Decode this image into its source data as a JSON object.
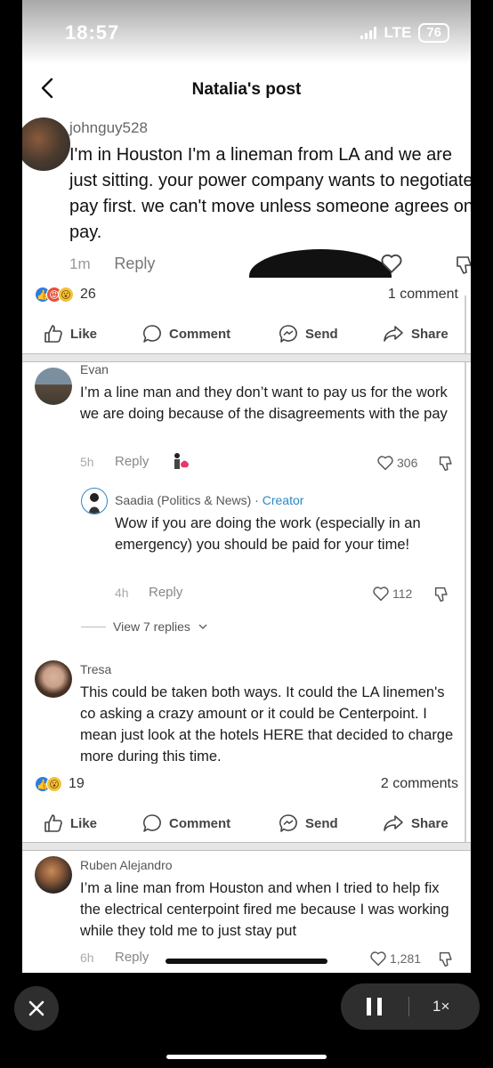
{
  "status": {
    "time": "18:57",
    "network": "LTE",
    "battery": "76"
  },
  "header": {
    "title": "Natalia's post"
  },
  "top_comment": {
    "username": "johnguy528",
    "text": "I'm in Houston I'm a lineman from LA and we are just sitting. your power company wants to negotiate pay first. we can't move unless someone agrees on pay.",
    "time": "1m",
    "reply_label": "Reply"
  },
  "post1": {
    "reaction_count": "26",
    "comments_label": "1 comment"
  },
  "actions": {
    "like": "Like",
    "comment": "Comment",
    "send": "Send",
    "share": "Share"
  },
  "comments": [
    {
      "name": "Evan",
      "text": "I’m a line man and they don’t want to pay us for the work we are doing because of the disagreements with the pay",
      "time": "5h",
      "reply": "Reply",
      "likes": "306"
    },
    {
      "name": "Saadia (Politics & News)",
      "sep": " · ",
      "badge": "Creator",
      "text": "Wow if you are doing the work (especially in an emergency) you should be paid for your time!",
      "time": "4h",
      "reply": "Reply",
      "likes": "112"
    }
  ],
  "view_replies": "View 7 replies",
  "comment_tresa": {
    "name": "Tresa",
    "text": "This could be taken both ways. It could the LA linemen's co asking a crazy amount or it could be Centerpoint. I mean just look at the hotels HERE that decided to charge more during this time."
  },
  "post2": {
    "reaction_count": "19",
    "comments_label": "2 comments"
  },
  "comment_ruben": {
    "name": "Ruben Alejandro",
    "text": "I’m a line man from Houston and when I tried to help fix the electrical centerpoint fired me because I was working while they told me to just stay put",
    "time": "6h",
    "reply": "Reply",
    "likes": "1,281"
  },
  "player": {
    "speed": "1×"
  }
}
